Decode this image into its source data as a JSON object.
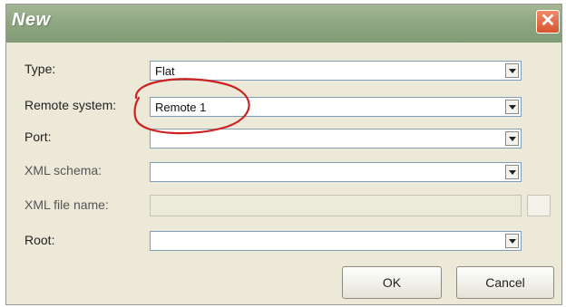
{
  "window": {
    "title": "New",
    "close_symbol": "✕"
  },
  "fields": [
    {
      "label": "Type:",
      "value": "Flat"
    },
    {
      "label": "Remote system:",
      "value": "Remote 1"
    },
    {
      "label": "Port:",
      "value": ""
    },
    {
      "label": "XML schema:",
      "value": ""
    },
    {
      "label": "XML file name:",
      "value": ""
    },
    {
      "label": "Root:",
      "value": ""
    }
  ],
  "buttons": {
    "ok": "OK",
    "cancel": "Cancel"
  },
  "colors": {
    "annotation": "#cc2222",
    "title_bar": "#8fa883"
  },
  "icons": {
    "dropdown": "chevron-down-icon",
    "close": "close-icon",
    "browse": "ellipsis-icon"
  }
}
